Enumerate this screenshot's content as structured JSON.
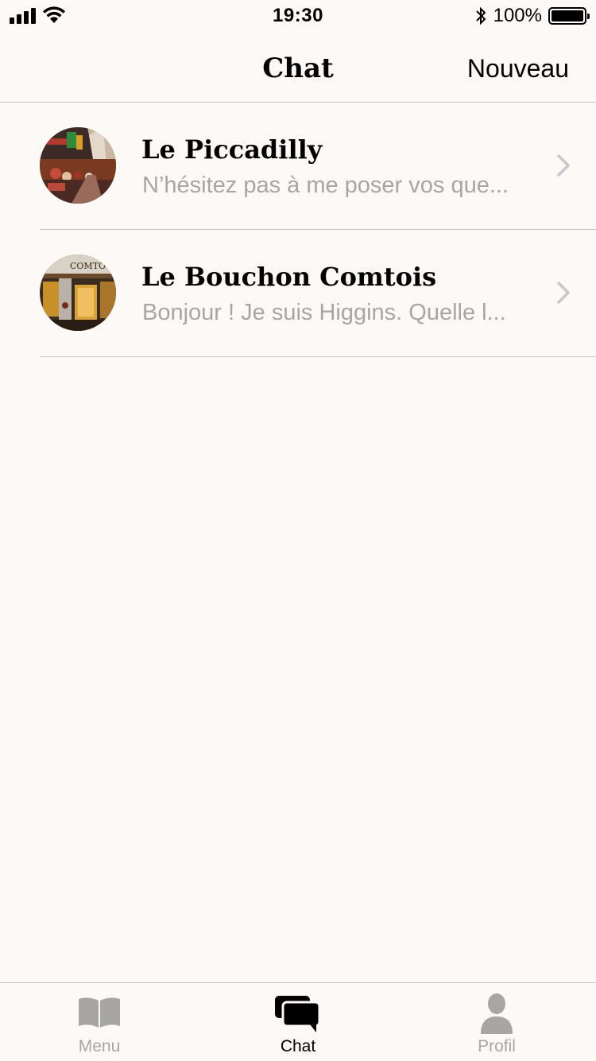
{
  "status_bar": {
    "time": "19:30",
    "battery_percent": "100%",
    "battery_level": 1.0,
    "icons": [
      "signal-icon",
      "wifi-icon",
      "bluetooth-icon",
      "battery-icon"
    ]
  },
  "nav": {
    "title": "Chat",
    "action_label": "Nouveau"
  },
  "chats": [
    {
      "name": "Le Piccadilly",
      "preview": "N’hésitez pas à me poser vos que...",
      "avatar": "restaurant-photo"
    },
    {
      "name": "Le Bouchon Comtois",
      "preview": "Bonjour ! Je suis Higgins. Quelle l...",
      "avatar": "restaurant-photo",
      "avatar_sign_text": "COMTO"
    }
  ],
  "tabs": [
    {
      "label": "Menu",
      "icon": "book-icon",
      "active": false
    },
    {
      "label": "Chat",
      "icon": "chat-bubbles-icon",
      "active": true
    },
    {
      "label": "Profil",
      "icon": "person-icon",
      "active": false
    }
  ],
  "colors": {
    "background": "#fcf9f6",
    "separator": "#c8c6c4",
    "muted_text": "#a8a6a4",
    "active_tab": "#000000",
    "inactive_tab": "#a8a6a4"
  }
}
